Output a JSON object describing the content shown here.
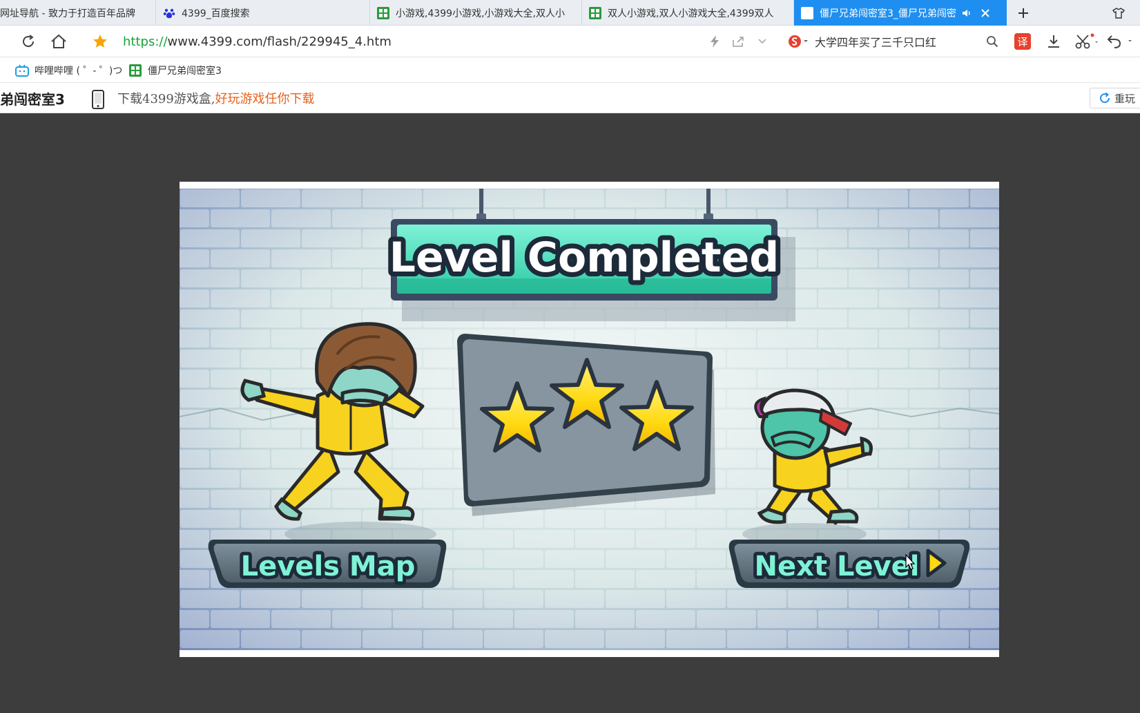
{
  "tabs": [
    {
      "label": "网址导航 - 致力于打造百年品牌",
      "icon": "none"
    },
    {
      "label": "4399_百度搜索",
      "icon": "baidu-paw-icon"
    },
    {
      "label": "小游戏,4399小游戏,小游戏大全,双人小",
      "icon": "4399-logo-icon"
    },
    {
      "label": "双人小游戏,双人小游戏大全,4399双人",
      "icon": "4399-logo-icon"
    },
    {
      "label": "僵尸兄弟闯密室3_僵尸兄弟闯密",
      "icon": "4399-logo-icon",
      "active": true
    }
  ],
  "address": {
    "protocol": "https://",
    "rest": "www.4399.com/flash/229945_4.htm",
    "search_text": "大学四年买了三千只口红",
    "translate_label": "译"
  },
  "bookmarks": [
    {
      "label": "哔哩哔哩 ( ゜- ゜)つ",
      "icon": "bilibili-tv-icon"
    },
    {
      "label": "僵尸兄弟闯密室3",
      "icon": "4399-logo-icon"
    }
  ],
  "page": {
    "title": "弟闯密室3",
    "promo_normal": "下载4399游戏盒,",
    "promo_highlight": "好玩游戏任你下载",
    "replay_label": "重玩"
  },
  "game": {
    "banner": "Level Completed",
    "stars_earned": 3,
    "stars_total": 3,
    "levels_map_label": "Levels Map",
    "next_level_label": "Next Level"
  },
  "colors": {
    "active_tab": "#1e8ff0",
    "url_protocol": "#18a33a",
    "banner_green": "#3ee0b8",
    "star_yellow": "#ffe11a",
    "suit_yellow": "#f7d21e",
    "button_slate": "#5d6d78"
  }
}
